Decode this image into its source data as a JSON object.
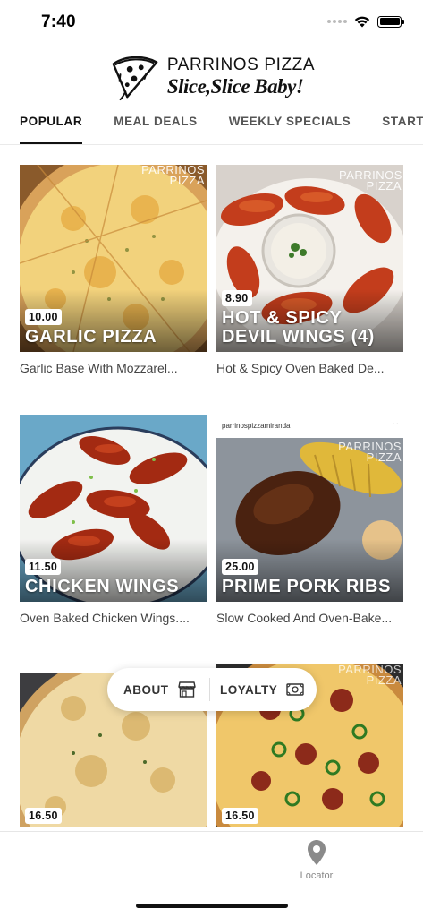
{
  "status_bar": {
    "time": "7:40"
  },
  "header": {
    "logo_title": "PARRINOS PIZZA",
    "logo_tagline": "Slice,Slice Baby!"
  },
  "tabs": [
    {
      "label": "POPULAR",
      "active": true
    },
    {
      "label": "MEAL DEALS",
      "active": false
    },
    {
      "label": "WEEKLY SPECIALS",
      "active": false
    },
    {
      "label": "STARTERS",
      "active": false
    }
  ],
  "products": [
    {
      "price": "10.00",
      "title": "GARLIC PIZZA",
      "description": "Garlic Base With Mozzarel...",
      "watermark": "PARRINOS PIZZA"
    },
    {
      "price": "8.90",
      "title": "HOT & SPICY DEVIL WINGS (4)",
      "description": "Hot & Spicy Oven Baked De...",
      "watermark": "PARRINOS PIZZA"
    },
    {
      "price": "11.50",
      "title": "CHICKEN WINGS",
      "description": "Oven Baked Chicken Wings...."
    },
    {
      "price": "25.00",
      "title": "PRIME PORK RIBS",
      "description": "Slow Cooked And Oven-Bake...",
      "image_caption": "parrinospizzamiranda",
      "watermark": "PARRINOS PIZZA"
    },
    {
      "price": "16.50",
      "title": "",
      "description": ""
    },
    {
      "price": "16.50",
      "title": "",
      "description": "",
      "watermark": "PARRINOS PIZZA"
    }
  ],
  "floating_menu": {
    "about_label": "ABOUT",
    "loyalty_label": "LOYALTY"
  },
  "bottom_nav": {
    "locator_label": "Locator"
  },
  "colors": {
    "text_primary": "#111111",
    "tab_inactive": "#555555",
    "badge_bg": "#ffffff",
    "icon_gray": "#8a8a8a"
  },
  "icons": [
    "wifi-icon",
    "battery-icon",
    "pizza-logo-icon",
    "shop-icon",
    "cash-icon",
    "location-pin-icon"
  ]
}
